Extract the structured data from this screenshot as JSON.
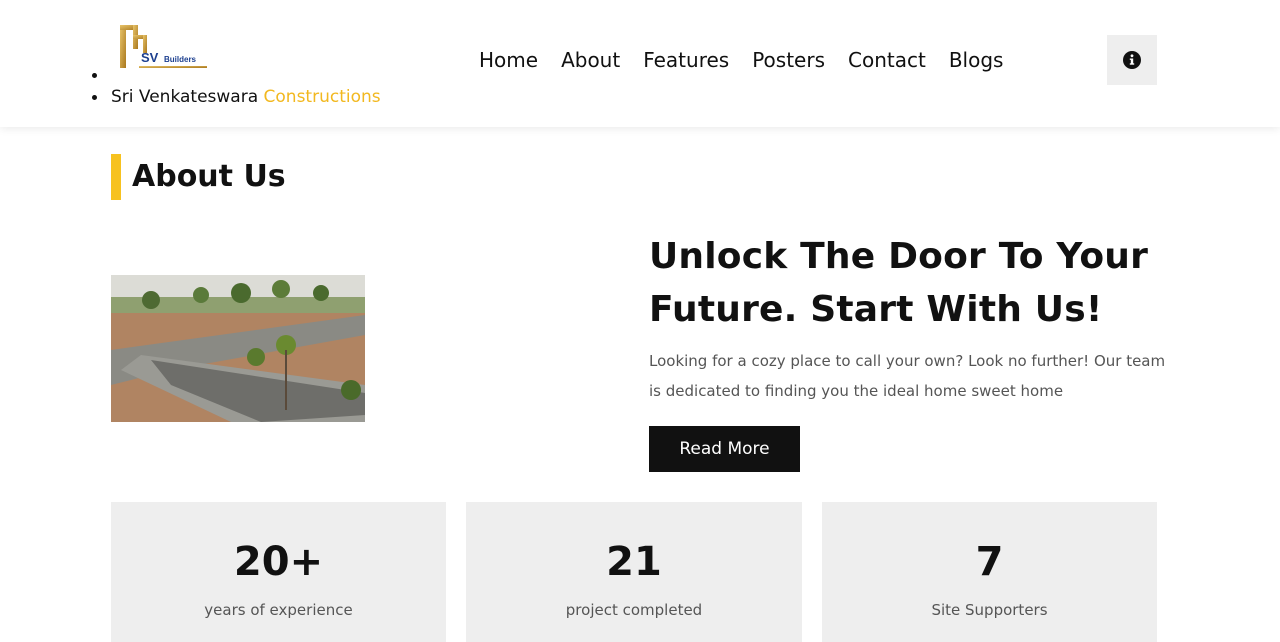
{
  "header": {
    "logo_text": "SV Builders",
    "brand_name": "Sri Venkateswara",
    "brand_accent": "Constructions",
    "nav": [
      "Home",
      "About",
      "Features",
      "Posters",
      "Contact",
      "Blogs"
    ],
    "info_icon": "info-circle-icon"
  },
  "about": {
    "section_title": "About Us",
    "headline": "Unlock The Door To Your Future. Start With Us!",
    "description": "Looking for a cozy place to call your own? Look no further! Our team is dedicated to finding you the ideal home sweet home",
    "button_label": "Read More"
  },
  "stats": [
    {
      "value": "20+",
      "label": "years of experience"
    },
    {
      "value": "21",
      "label": "project completed"
    },
    {
      "value": "7",
      "label": "Site Supporters"
    }
  ],
  "colors": {
    "accent": "#f2b81f",
    "dark": "#111111",
    "panel": "#eeeeee"
  }
}
